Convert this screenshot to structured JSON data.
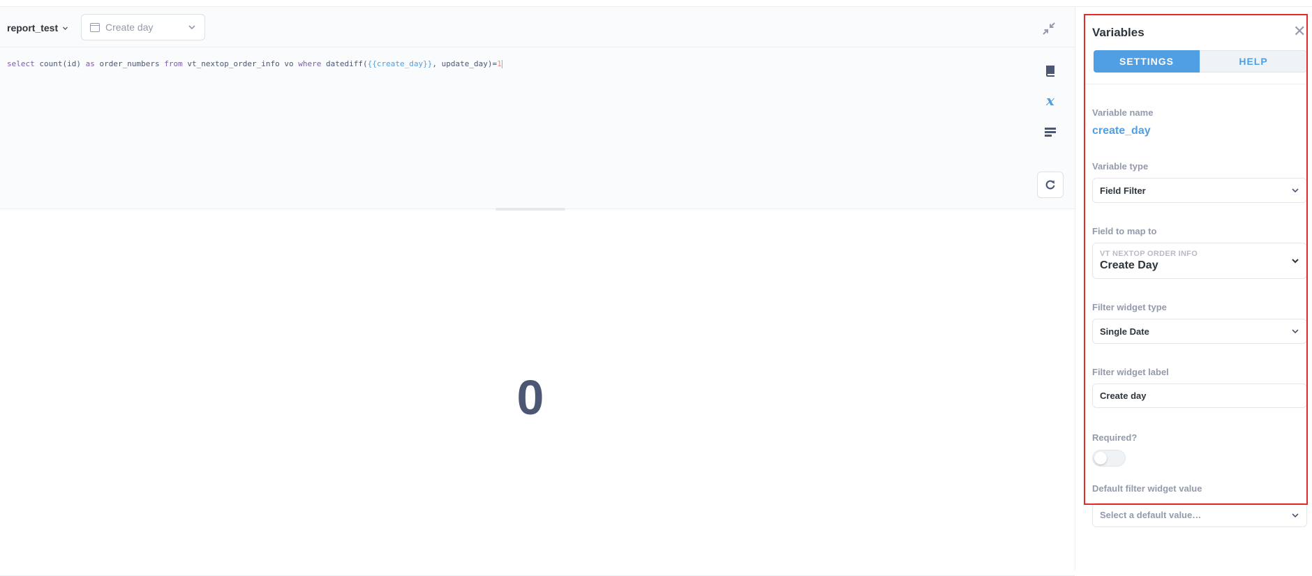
{
  "header": {
    "database": "report_test",
    "widget_label": "Create day"
  },
  "editor": {
    "sql": {
      "kw_select": "select",
      "t1": " count(id) ",
      "kw_as": "as",
      "t2": " order_numbers ",
      "kw_from": "from",
      "t3": " vt_nextop_order_info vo ",
      "kw_where": "where",
      "t4": " datediff(",
      "variable": "{{create_day}}",
      "t5": ", update_day)=",
      "number": "1"
    }
  },
  "result": {
    "value": "0"
  },
  "variables_panel": {
    "title": "Variables",
    "close_label": "✕",
    "tabs": {
      "settings": "SETTINGS",
      "help": "HELP"
    },
    "variable_name_label": "Variable name",
    "variable_name": "create_day",
    "variable_type_label": "Variable type",
    "variable_type": "Field Filter",
    "field_to_map_label": "Field to map to",
    "field_table": "VT NEXTOP ORDER INFO",
    "field_name": "Create Day",
    "filter_widget_type_label": "Filter widget type",
    "filter_widget_type": "Single Date",
    "filter_widget_label_label": "Filter widget label",
    "filter_widget_label_value": "Create day",
    "required_label": "Required?",
    "required": false,
    "default_value_label": "Default filter widget value",
    "default_value_placeholder": "Select a default value…"
  },
  "colors": {
    "brand": "#509ee3",
    "highlight_border": "#e5292b",
    "text_dark": "#2e353b",
    "text_medium": "#4c5773",
    "text_light": "#949aab"
  },
  "icons": {
    "collapse": "collapse-arrows-icon",
    "data_reference": "book-icon",
    "variables": "variable-x-icon",
    "snippets": "snippet-lines-icon",
    "run": "refresh-icon",
    "calendar": "calendar-icon",
    "chevron": "chevron-down-icon",
    "close": "close-icon"
  }
}
